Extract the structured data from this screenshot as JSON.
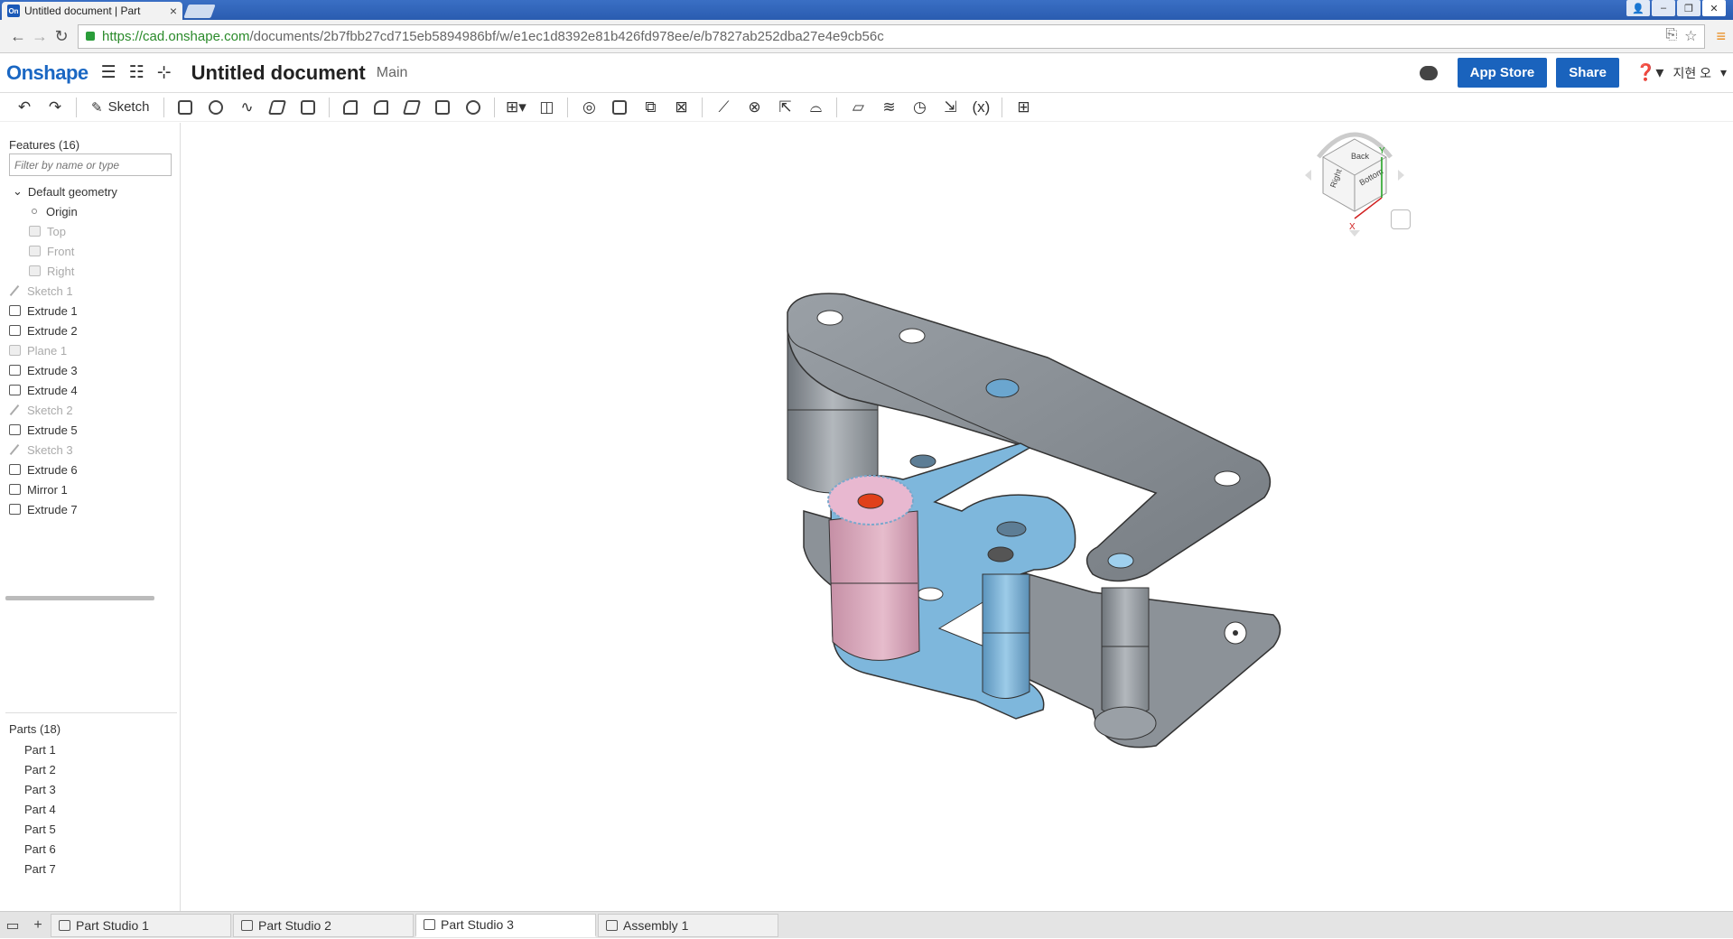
{
  "browser": {
    "tab_title": "Untitled document | Part",
    "tab_favicon": "On",
    "url_host": "https://cad.onshape.com",
    "url_rest": "/documents/2b7fbb27cd715eb5894986bf/w/e1ec1d8392e81b426fd978ee/e/b7827ab252dba27e4e9cb56c"
  },
  "header": {
    "logo": "Onshape",
    "doc_title": "Untitled document",
    "workspace": "Main",
    "app_store": "App Store",
    "share": "Share",
    "user": "지현 오"
  },
  "toolbar": {
    "sketch_label": "Sketch",
    "variable_label": "(x)"
  },
  "features": {
    "header": "Features (16)",
    "filter_placeholder": "Filter by name or type",
    "default_geometry": "Default geometry",
    "items": [
      {
        "label": "Origin",
        "kind": "origin",
        "dim": false
      },
      {
        "label": "Top",
        "kind": "plane",
        "dim": true
      },
      {
        "label": "Front",
        "kind": "plane",
        "dim": true
      },
      {
        "label": "Right",
        "kind": "plane",
        "dim": true
      },
      {
        "label": "Sketch 1",
        "kind": "sketch",
        "dim": true
      },
      {
        "label": "Extrude 1",
        "kind": "extrude",
        "dim": false
      },
      {
        "label": "Extrude 2",
        "kind": "extrude",
        "dim": false
      },
      {
        "label": "Plane 1",
        "kind": "plane",
        "dim": true
      },
      {
        "label": "Extrude 3",
        "kind": "extrude",
        "dim": false
      },
      {
        "label": "Extrude 4",
        "kind": "extrude",
        "dim": false
      },
      {
        "label": "Sketch 2",
        "kind": "sketch",
        "dim": true
      },
      {
        "label": "Extrude 5",
        "kind": "extrude",
        "dim": false
      },
      {
        "label": "Sketch 3",
        "kind": "sketch",
        "dim": true
      },
      {
        "label": "Extrude 6",
        "kind": "extrude",
        "dim": false
      },
      {
        "label": "Mirror 1",
        "kind": "mirror",
        "dim": false
      },
      {
        "label": "Extrude 7",
        "kind": "extrude",
        "dim": false
      }
    ]
  },
  "parts": {
    "header": "Parts (18)",
    "items": [
      "Part 1",
      "Part 2",
      "Part 3",
      "Part 4",
      "Part 5",
      "Part 6",
      "Part 7"
    ]
  },
  "viewcube": {
    "faces": [
      "Back",
      "Right",
      "Bottom"
    ],
    "axes": [
      "Y",
      "X"
    ]
  },
  "bottom_tabs": [
    {
      "label": "Part Studio 1",
      "active": false
    },
    {
      "label": "Part Studio 2",
      "active": false
    },
    {
      "label": "Part Studio 3",
      "active": true
    },
    {
      "label": "Assembly 1",
      "active": false
    }
  ],
  "colors": {
    "brand": "#1a63bd",
    "part_grey": "#8a9096",
    "part_blue": "#7eb7dc",
    "part_pink": "#d8a6b8",
    "highlight_red": "#e0401a"
  }
}
